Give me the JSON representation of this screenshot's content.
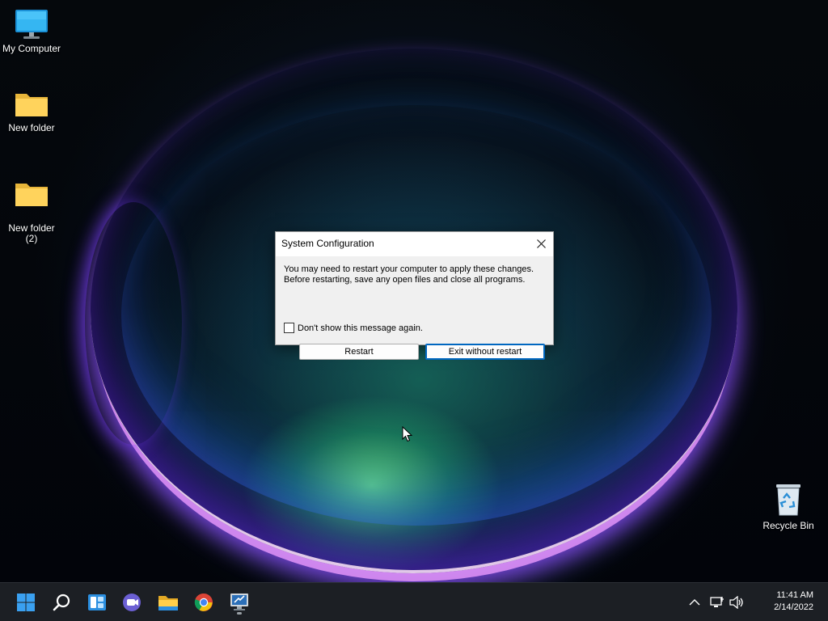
{
  "desktop": {
    "icons": [
      {
        "label": "My Computer",
        "icon": "computer-icon"
      },
      {
        "label": "New folder",
        "icon": "folder-icon"
      },
      {
        "label": "New folder\n(2)",
        "icon": "folder-icon"
      },
      {
        "label": "Recycle Bin",
        "icon": "recycle-bin-icon"
      }
    ]
  },
  "dialog": {
    "title": "System Configuration",
    "message_line1": "You may need to restart your computer to apply these changes.",
    "message_line2": "Before restarting, save any open files and close all programs.",
    "checkbox_label": "Don't show this message again.",
    "checkbox_checked": false,
    "restart_label": "Restart",
    "exit_label": "Exit without restart",
    "close_icon": "close-icon"
  },
  "taskbar": {
    "apps": [
      {
        "name": "start",
        "icon": "windows-start-icon"
      },
      {
        "name": "search",
        "icon": "search-icon"
      },
      {
        "name": "widgets",
        "icon": "widgets-icon"
      },
      {
        "name": "chat",
        "icon": "teams-chat-icon"
      },
      {
        "name": "file-explorer",
        "icon": "file-explorer-icon"
      },
      {
        "name": "chrome",
        "icon": "chrome-icon"
      },
      {
        "name": "system-configuration",
        "icon": "msconfig-icon",
        "active": true
      }
    ],
    "tray": {
      "icons": [
        "chevron-up-icon",
        "network-icon",
        "volume-icon"
      ],
      "time": "11:41 AM",
      "date": "2/14/2022"
    }
  },
  "colors": {
    "taskbar_bg": "#1c1f24",
    "accent": "#0067c0",
    "dialog_body": "#f0f0f0"
  }
}
